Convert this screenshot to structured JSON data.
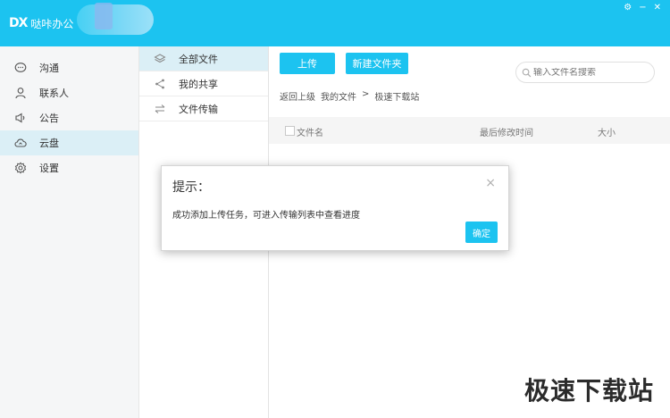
{
  "app": {
    "logo_mark": "DX",
    "title": "哒咔办公"
  },
  "window_controls": {
    "settings": "⚙",
    "minimize": "−",
    "close": "✕"
  },
  "nav": {
    "items": [
      {
        "label": "沟通",
        "icon": "chat-icon"
      },
      {
        "label": "联系人",
        "icon": "person-icon"
      },
      {
        "label": "公告",
        "icon": "megaphone-icon"
      },
      {
        "label": "云盘",
        "icon": "cloud-icon",
        "active": true
      },
      {
        "label": "设置",
        "icon": "gear-icon"
      }
    ]
  },
  "folders": {
    "items": [
      {
        "label": "全部文件",
        "icon": "layers-icon",
        "active": true
      },
      {
        "label": "我的共享",
        "icon": "share-icon"
      },
      {
        "label": "文件传输",
        "icon": "transfer-icon"
      }
    ]
  },
  "toolbar": {
    "upload_label": "上传",
    "new_folder_label": "新建文件夹",
    "search_placeholder": "输入文件名搜索"
  },
  "breadcrumb": {
    "back": "返回上级",
    "root": "我的文件",
    "sep": ">",
    "current": "极速下载站"
  },
  "table": {
    "columns": [
      "文件名",
      "最后修改时间",
      "大小"
    ]
  },
  "dialog": {
    "title": "提示：",
    "close": "×",
    "message": "成功添加上传任务，可进入传输列表中查看进度",
    "ok_label": "确定"
  },
  "watermark": "极速下载站",
  "colors": {
    "accent": "#1cc3f0",
    "active_bg": "#dbeff6"
  }
}
